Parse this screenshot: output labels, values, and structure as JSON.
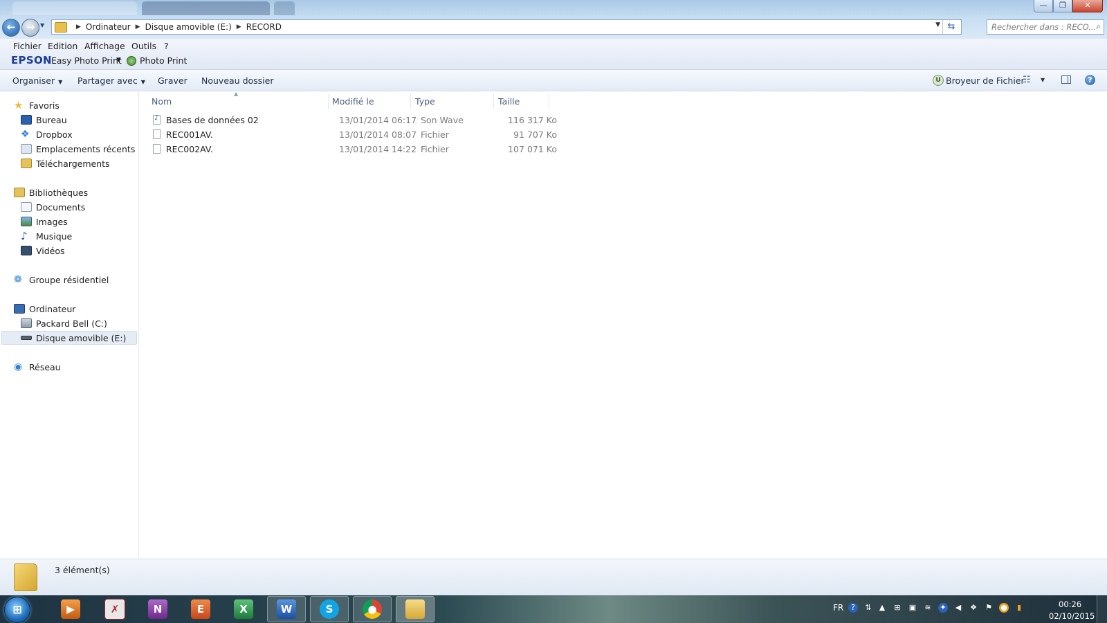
{
  "window": {
    "controls": {
      "minimize": "—",
      "maximize": "❐",
      "close": "✕"
    }
  },
  "address": {
    "crumbs": [
      "Ordinateur",
      "Disque amovible (E:)",
      "RECORD"
    ],
    "search_placeholder": "Rechercher dans : RECO..."
  },
  "menu": {
    "items": [
      "Fichier",
      "Edition",
      "Affichage",
      "Outils",
      "?"
    ]
  },
  "epson": {
    "logo": "EPSON",
    "easy_photo_print": "Easy Photo Print",
    "photo_print": "Photo Print"
  },
  "toolbar": {
    "organiser": "Organiser",
    "partager": "Partager avec",
    "graver": "Graver",
    "nouveau_dossier": "Nouveau dossier",
    "broyeur": "Broyeur de Fichier"
  },
  "nav": {
    "favoris": "Favoris",
    "bureau": "Bureau",
    "dropbox": "Dropbox",
    "recents": "Emplacements récents",
    "telechargements": "Téléchargements",
    "bibliotheques": "Bibliothèques",
    "documents": "Documents",
    "images": "Images",
    "musique": "Musique",
    "videos": "Vidéos",
    "groupe": "Groupe résidentiel",
    "ordinateur": "Ordinateur",
    "drive_c": "Packard Bell (C:)",
    "drive_e": "Disque amovible (E:)",
    "reseau": "Réseau"
  },
  "columns": {
    "name": "Nom",
    "modified": "Modifié le",
    "type": "Type",
    "size": "Taille"
  },
  "files": [
    {
      "name": "Bases de données 02",
      "modified": "13/01/2014 06:17",
      "type": "Son Wave",
      "size": "116 317 Ko"
    },
    {
      "name": "REC001AV.",
      "modified": "13/01/2014 08:07",
      "type": "Fichier",
      "size": "91 707 Ko"
    },
    {
      "name": "REC002AV.",
      "modified": "13/01/2014 14:22",
      "type": "Fichier",
      "size": "107 071 Ko"
    }
  ],
  "details": {
    "count": "3 élément(s)"
  },
  "taskbar": {
    "lang": "FR",
    "time": "00:26",
    "date": "02/10/2015"
  }
}
